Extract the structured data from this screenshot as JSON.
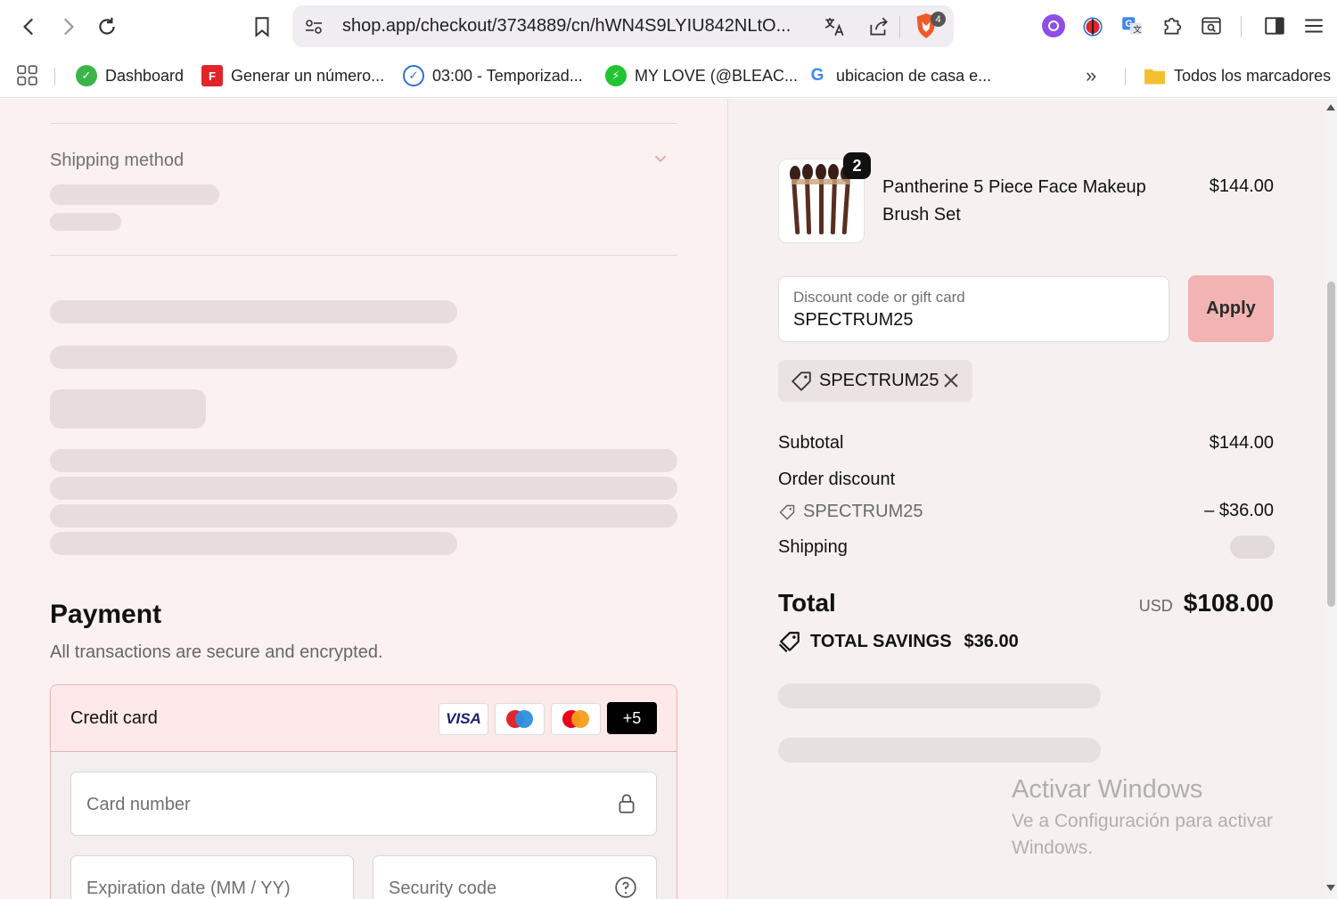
{
  "browser": {
    "url": "shop.app/checkout/3734889/cn/hWN4S9LYIU842NLtO...",
    "extension_badge_count": "4",
    "bookmarks": [
      {
        "label": "Dashboard",
        "icon": "dashboard-icon",
        "color": "#3ab54a"
      },
      {
        "label": "Generar un número...",
        "icon": "f-logo-icon",
        "color": "#e0262b"
      },
      {
        "label": "03:00 - Temporizad...",
        "icon": "timer-check-icon",
        "color": "#2d6fdc"
      },
      {
        "label": "MY LOVE (@BLEAC...",
        "icon": "bolt-icon",
        "color": "#21c431"
      },
      {
        "label": "ubicacion de casa e...",
        "icon": "google-icon",
        "color": "#4285f4"
      }
    ],
    "all_bookmarks_label": "Todos los marcadores"
  },
  "checkout": {
    "shipping_method_title": "Shipping method",
    "payment": {
      "title": "Payment",
      "subtitle": "All transactions are secure and encrypted.",
      "method_label": "Credit card",
      "card_brands": [
        "VISA",
        "Maestro",
        "Mastercard"
      ],
      "more_cards": "+5",
      "card_number_placeholder": "Card number",
      "expiration_placeholder": "Expiration date (MM / YY)",
      "security_placeholder": "Security code"
    }
  },
  "summary": {
    "product": {
      "name": "Pantherine 5 Piece Face Makeup Brush Set",
      "price": "$144.00",
      "quantity": "2"
    },
    "discount_input": {
      "label": "Discount code or gift card",
      "value": "SPECTRUM25"
    },
    "apply_label": "Apply",
    "applied_code": "SPECTRUM25",
    "subtotal_label": "Subtotal",
    "subtotal_value": "$144.00",
    "order_discount_label": "Order discount",
    "order_discount_code": "SPECTRUM25",
    "order_discount_value": "– $36.00",
    "shipping_label": "Shipping",
    "total_label": "Total",
    "currency": "USD",
    "total_value": "$108.00",
    "savings_label": "TOTAL SAVINGS",
    "savings_value": "$36.00"
  },
  "watermark": {
    "title": "Activar Windows",
    "subtitle": "Ve a Configuración para activar Windows."
  },
  "colors": {
    "apply_button": "#f2b3b3",
    "left_background": "#fbf1f1",
    "right_background": "#f6f1f0",
    "selected_border": "#e8b3b3"
  }
}
